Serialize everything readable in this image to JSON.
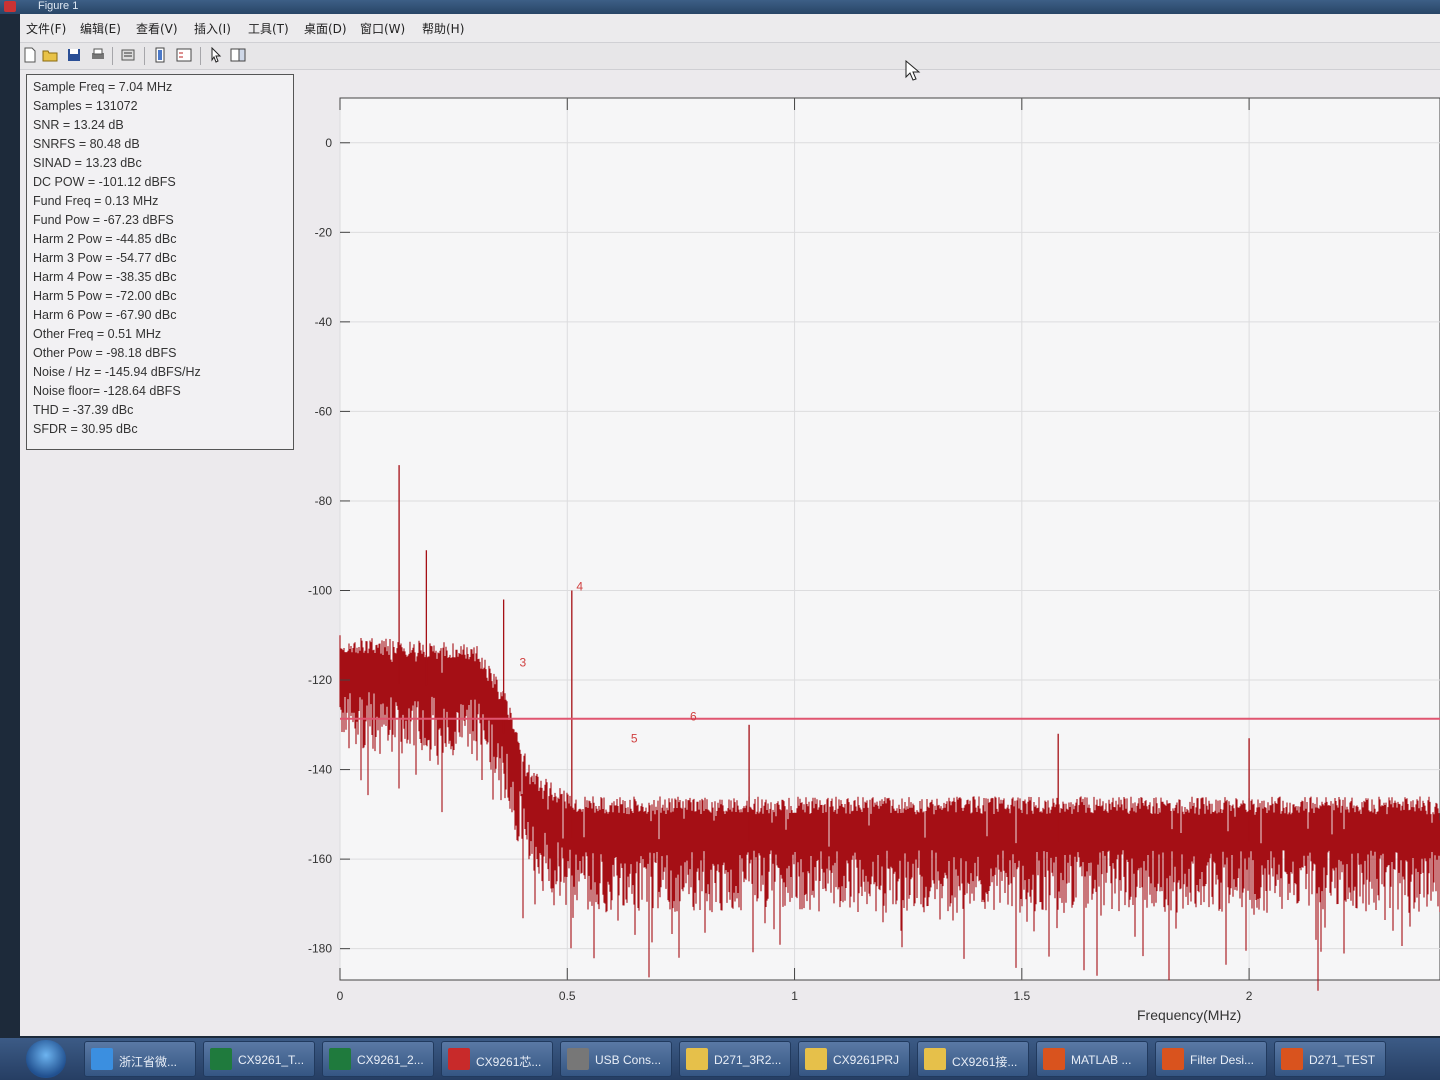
{
  "window": {
    "title": "Figure 1"
  },
  "menu": [
    "文件(F)",
    "编辑(E)",
    "查看(V)",
    "插入(I)",
    "工具(T)",
    "桌面(D)",
    "窗口(W)",
    "帮助(H)"
  ],
  "toolbar_icons": [
    "new-figure-icon",
    "open-icon",
    "save-icon",
    "print-icon",
    "link-icon",
    "colorbar-icon",
    "legend-icon",
    "pointer-icon",
    "property-editor-icon"
  ],
  "stats": [
    "Sample Freq = 7.04 MHz",
    "Samples = 131072",
    "SNR = 13.24 dB",
    "SNRFS = 80.48 dB",
    "SINAD = 13.23 dBc",
    "DC POW = -101.12 dBFS",
    "Fund Freq = 0.13 MHz",
    "Fund Pow = -67.23 dBFS",
    "Harm 2 Pow = -44.85 dBc",
    "Harm 3 Pow = -54.77 dBc",
    "Harm 4 Pow = -38.35 dBc",
    "Harm 5 Pow = -72.00 dBc",
    "Harm 6 Pow = -67.90 dBc",
    "Other Freq = 0.51 MHz",
    "Other Pow = -98.18 dBFS",
    "Noise / Hz = -145.94 dBFS/Hz",
    "Noise floor= -128.64 dBFS",
    "THD = -37.39 dBc",
    "SFDR = 30.95 dBc"
  ],
  "chart_data": {
    "type": "line",
    "xlabel": "Frequency(MHz)",
    "ylabel": "",
    "xlim": [
      0,
      2.42
    ],
    "ylim": [
      -187,
      10
    ],
    "x_ticks": [
      0,
      0.5,
      1,
      1.5,
      2
    ],
    "x_tick_labels": [
      "0",
      "0.5",
      "1",
      "1.5",
      "2"
    ],
    "y_ticks": [
      0,
      -20,
      -40,
      -60,
      -80,
      -100,
      -120,
      -140,
      -160,
      -180
    ],
    "y_tick_labels": [
      "0",
      "-20",
      "-40",
      "-60",
      "-80",
      "-100",
      "-120",
      "-140",
      "-160",
      "-180"
    ],
    "grid": true,
    "color": "#a50f15",
    "spectrum_envelope": [
      {
        "x": 0.0,
        "y": -110
      },
      {
        "x": 0.3,
        "y": -112
      },
      {
        "x": 0.36,
        "y": -122
      },
      {
        "x": 0.42,
        "y": -140
      },
      {
        "x": 0.5,
        "y": -145
      },
      {
        "x": 0.53,
        "y": -146
      },
      {
        "x": 2.42,
        "y": -146
      }
    ],
    "spurs": [
      {
        "x": 0.13,
        "y": -72
      },
      {
        "x": 0.19,
        "y": -91
      },
      {
        "x": 0.36,
        "y": -102
      },
      {
        "x": 0.51,
        "y": -100
      },
      {
        "x": 0.9,
        "y": -130
      },
      {
        "x": 1.58,
        "y": -132
      },
      {
        "x": 2.0,
        "y": -133
      }
    ],
    "noise_floor_line": -128.64,
    "noise_floor_color": "#e05570",
    "markers": [
      {
        "label": "3",
        "x": 0.395,
        "y": -117
      },
      {
        "label": "4",
        "x": 0.52,
        "y": -100
      },
      {
        "label": "5",
        "x": 0.64,
        "y": -134
      },
      {
        "label": "6",
        "x": 0.77,
        "y": -129
      }
    ]
  },
  "taskbar": {
    "tasks": [
      {
        "label": "浙江省微...",
        "icon": "ie-icon"
      },
      {
        "label": "CX9261_T...",
        "icon": "excel-icon"
      },
      {
        "label": "CX9261_2...",
        "icon": "excel-icon"
      },
      {
        "label": "CX9261芯...",
        "icon": "pdf-icon"
      },
      {
        "label": "USB Cons...",
        "icon": "usb-icon"
      },
      {
        "label": "D271_3R2...",
        "icon": "folder-icon"
      },
      {
        "label": "CX9261PRJ",
        "icon": "folder-icon"
      },
      {
        "label": "CX9261接...",
        "icon": "folder-icon"
      },
      {
        "label": "MATLAB ...",
        "icon": "matlab-icon"
      },
      {
        "label": "Filter Desi...",
        "icon": "matlab-icon"
      },
      {
        "label": "D271_TEST",
        "icon": "matlab-icon"
      }
    ]
  }
}
